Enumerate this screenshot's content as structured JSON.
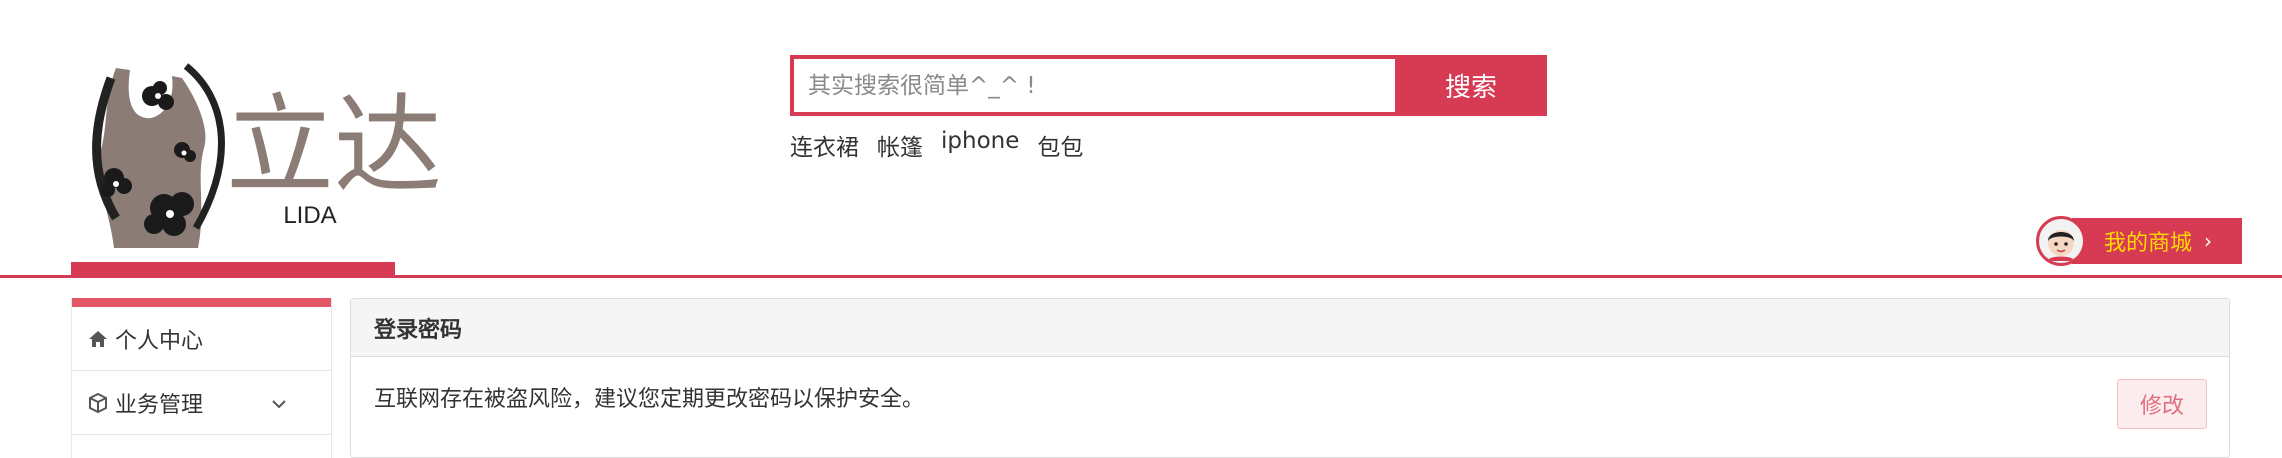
{
  "brand": {
    "logo_cn": "立达",
    "logo_en": "LIDA"
  },
  "search": {
    "placeholder": "其实搜索很简单^_^ !",
    "button_label": "搜索"
  },
  "hot_links": [
    "连衣裙",
    "帐篷",
    "iphone",
    "包包"
  ],
  "my_mall": {
    "label": "我的商城",
    "chevron": "›"
  },
  "sidebar": {
    "items": [
      {
        "label": "个人中心",
        "icon": "home-icon"
      },
      {
        "label": "业务管理",
        "icon": "box-icon",
        "expandable": true
      }
    ]
  },
  "panel": {
    "title": "登录密码",
    "message": "互联网存在被盗风险，建议您定期更改密码以保护安全。",
    "edit_label": "修改"
  },
  "colors": {
    "accent": "#d63b53",
    "mall_text": "#ffd900",
    "logo_brown": "#8b7d76"
  }
}
